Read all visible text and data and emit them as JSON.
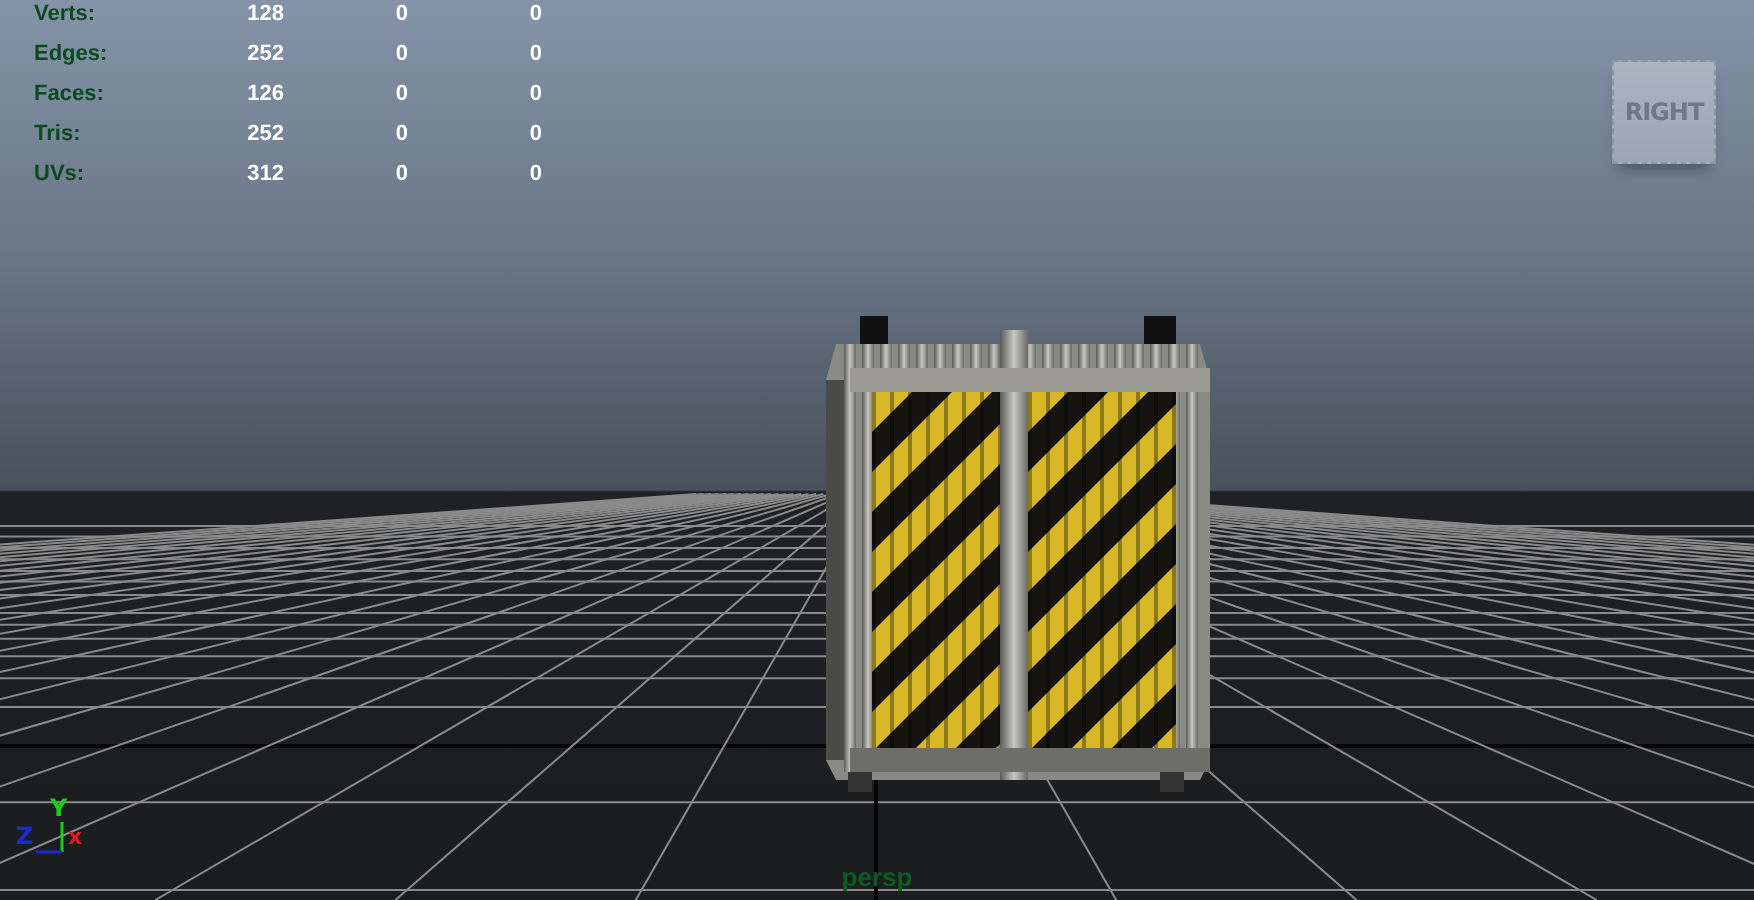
{
  "viewport": {
    "camera": "persp",
    "stats": [
      {
        "label": "Verts:",
        "values": [
          "128",
          "0",
          "0"
        ]
      },
      {
        "label": "Edges:",
        "values": [
          "252",
          "0",
          "0"
        ]
      },
      {
        "label": "Faces:",
        "values": [
          "126",
          "0",
          "0"
        ]
      },
      {
        "label": "Tris:",
        "values": [
          "252",
          "0",
          "0"
        ]
      },
      {
        "label": "UVs:",
        "values": [
          "312",
          "0",
          "0"
        ]
      }
    ],
    "view_cube": {
      "label": "RIGHT"
    },
    "axis_gizmo": {
      "y_label": "Y",
      "z_label": "Z",
      "x_label": "x"
    }
  }
}
